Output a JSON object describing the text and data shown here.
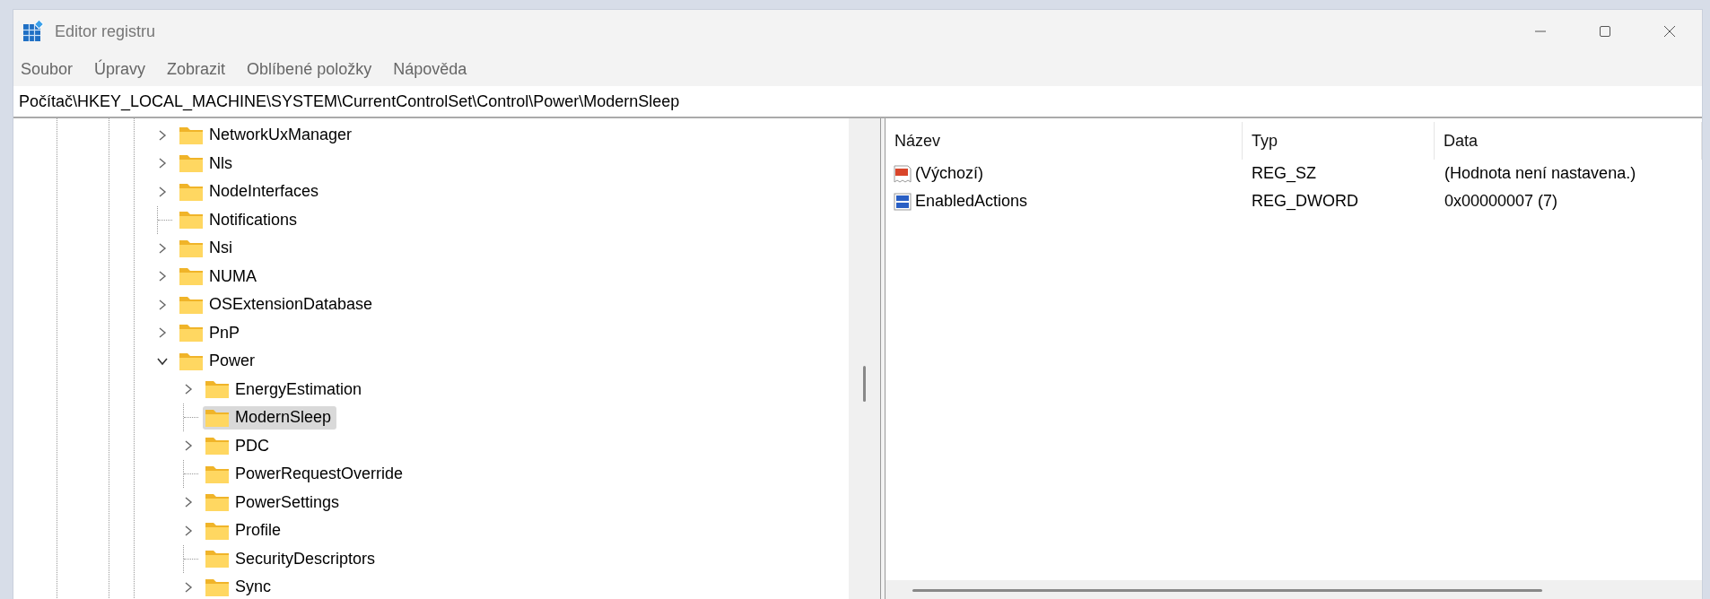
{
  "window": {
    "title": "Editor registru"
  },
  "menu": [
    "Soubor",
    "Úpravy",
    "Zobrazit",
    "Oblíbené položky",
    "Nápověda"
  ],
  "address": "Počítač\\HKEY_LOCAL_MACHINE\\SYSTEM\\CurrentControlSet\\Control\\Power\\ModernSleep",
  "tree": [
    {
      "label": "NetworkUxManager",
      "kind": "collapsed",
      "selected": false
    },
    {
      "label": "Nls",
      "kind": "collapsed",
      "selected": false
    },
    {
      "label": "NodeInterfaces",
      "kind": "collapsed",
      "selected": false
    },
    {
      "label": "Notifications",
      "kind": "leaf",
      "selected": false
    },
    {
      "label": "Nsi",
      "kind": "collapsed",
      "selected": false
    },
    {
      "label": "NUMA",
      "kind": "collapsed",
      "selected": false
    },
    {
      "label": "OSExtensionDatabase",
      "kind": "collapsed",
      "selected": false
    },
    {
      "label": "PnP",
      "kind": "collapsed",
      "selected": false
    },
    {
      "label": "Power",
      "kind": "expanded",
      "selected": false,
      "children": [
        {
          "label": "EnergyEstimation",
          "kind": "collapsed",
          "selected": false
        },
        {
          "label": "ModernSleep",
          "kind": "leaf",
          "selected": true
        },
        {
          "label": "PDC",
          "kind": "collapsed",
          "selected": false
        },
        {
          "label": "PowerRequestOverride",
          "kind": "leaf",
          "selected": false
        },
        {
          "label": "PowerSettings",
          "kind": "collapsed",
          "selected": false
        },
        {
          "label": "Profile",
          "kind": "collapsed",
          "selected": false
        },
        {
          "label": "SecurityDescriptors",
          "kind": "leaf",
          "selected": false
        },
        {
          "label": "Sync",
          "kind": "collapsed",
          "selected": false
        }
      ]
    }
  ],
  "values": {
    "columns": [
      "Název",
      "Typ",
      "Data"
    ],
    "rows": [
      {
        "kind": "string",
        "name": "(Výchozí)",
        "type": "REG_SZ",
        "data": "(Hodnota není nastavena.)"
      },
      {
        "kind": "binary",
        "name": "EnabledActions",
        "type": "REG_DWORD",
        "data": "0x00000007 (7)"
      }
    ]
  }
}
